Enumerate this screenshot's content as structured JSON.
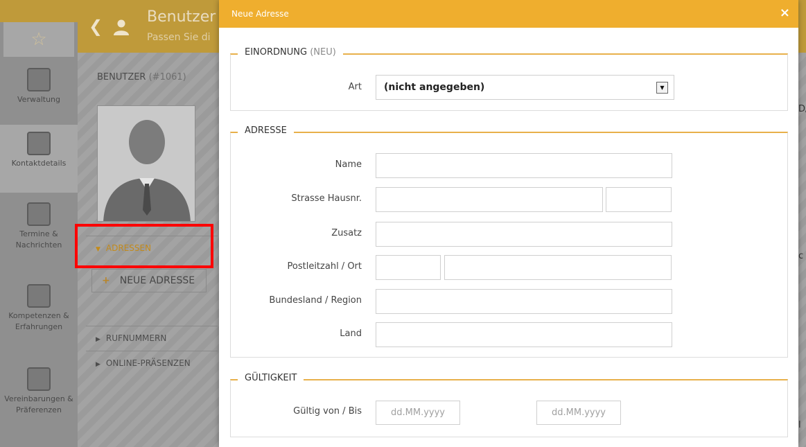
{
  "background": {
    "page_title": "Benutzer",
    "page_subtitle": "Passen Sie di",
    "sidebar": [
      {
        "label": "Verwaltung"
      },
      {
        "label": "Kontaktdetails"
      },
      {
        "label": "Termine & Nachrichten"
      },
      {
        "label": "Kompetenzen & Erfahrungen"
      },
      {
        "label": "Vereinbarungen & Präferenzen"
      }
    ],
    "user_section": {
      "label": "BENUTZER",
      "id": "(#1061)"
    },
    "accordion": {
      "addresses": "ADRESSEN",
      "new_address": "NEUE ADRESSE",
      "phone_numbers": "RUFNUMMERN",
      "online_presences": "ONLINE-PRÄSENZEN"
    },
    "right_peek": [
      "D/",
      "c",
      "l"
    ]
  },
  "modal": {
    "title": "Neue Adresse",
    "close_icon": "×",
    "classification": {
      "legend": "EINORDNUNG",
      "legend_suffix": "(NEU)",
      "type_label": "Art",
      "type_value": "(nicht angegeben)"
    },
    "address": {
      "legend": "ADRESSE",
      "name_label": "Name",
      "street_label": "Strasse Hausnr.",
      "extra_label": "Zusatz",
      "zip_city_label": "Postleitzahl / Ort",
      "state_label": "Bundesland / Region",
      "country_label": "Land"
    },
    "validity": {
      "legend": "GÜLTIGKEIT",
      "label": "Gültig von / Bis",
      "from_placeholder": "dd.MM.yyyy",
      "to_placeholder": "dd.MM.yyyy"
    }
  },
  "colors": {
    "accent": "#efae2e",
    "highlight": "#ff0000"
  }
}
